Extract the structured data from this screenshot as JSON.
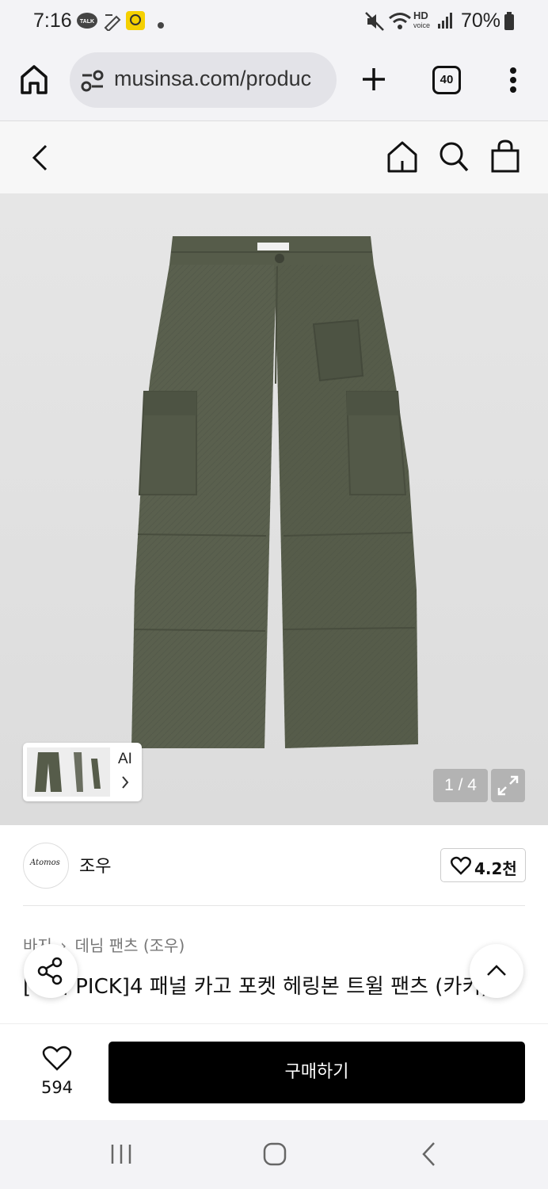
{
  "status_bar": {
    "time": "7:16",
    "battery": "70%",
    "talk_badge": "TALK",
    "hd_label": "HD",
    "voice_label": "voice"
  },
  "browser": {
    "url": "musinsa.com/produc",
    "tab_count": "40"
  },
  "product": {
    "image_counter": "1 / 4",
    "ai_label": "AI",
    "brand": "조우",
    "brand_logo_text": "Atomos",
    "likes": "4.2천",
    "breadcrumb": [
      "바지",
      "데님 팬츠 (조우)"
    ],
    "breadcrumb_sep": "›",
    "title": "[무서 PICK]4 패널 카고 포켓 헤링본 트윌 팬츠 (카키)"
  },
  "action_bar": {
    "wish_count": "594",
    "buy_label": "구매하기"
  },
  "colors": {
    "buy_button": "#000000",
    "pants": "#565c4a",
    "background_hero": "#e0e0e0"
  }
}
